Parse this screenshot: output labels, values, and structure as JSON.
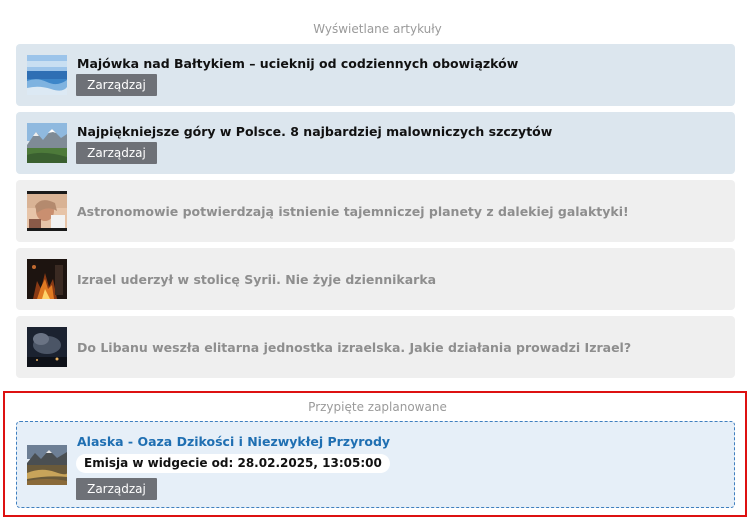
{
  "displayed": {
    "heading": "Wyświetlane artykuły",
    "articles": [
      {
        "title": "Majówka nad Bałtykiem – ucieknij od codziennych obowiązków",
        "state": "active",
        "thumbnail": "sea-coast-photo",
        "manage_label": "Zarządzaj"
      },
      {
        "title": "Najpiękniejsze góry w Polsce. 8 najbardziej malowniczych szczytów",
        "state": "active",
        "thumbnail": "mountains-photo",
        "manage_label": "Zarządzaj"
      },
      {
        "title": "Astronomowie potwierdzają istnienie tajemniczej planety z dalekiej galaktyki!",
        "state": "inactive",
        "thumbnail": "person-photo"
      },
      {
        "title": "Izrael uderzył w stolicę Syrii. Nie żyje dziennikarka",
        "state": "inactive",
        "thumbnail": "fire-night-photo"
      },
      {
        "title": "Do Libanu weszła elitarna jednostka izraelska. Jakie działania prowadzi Izrael?",
        "state": "inactive",
        "thumbnail": "smoke-night-photo"
      }
    ]
  },
  "pinned": {
    "heading": "Przypięte zaplanowane",
    "article": {
      "title": "Alaska - Oaza Dzikości i Niezwykłej Przyrody",
      "emission": "Emisja w widgecie od: 28.02.2025, 13:05:00",
      "thumbnail": "alaska-landscape-photo",
      "manage_label": "Zarządzaj"
    },
    "highlight_color": "#dd1111"
  },
  "colors": {
    "active_card": "#dce6ee",
    "inactive_card": "#efefef",
    "button": "#6e7177",
    "pinned_card": "#e6eff8",
    "pinned_title": "#1f6fb2"
  }
}
